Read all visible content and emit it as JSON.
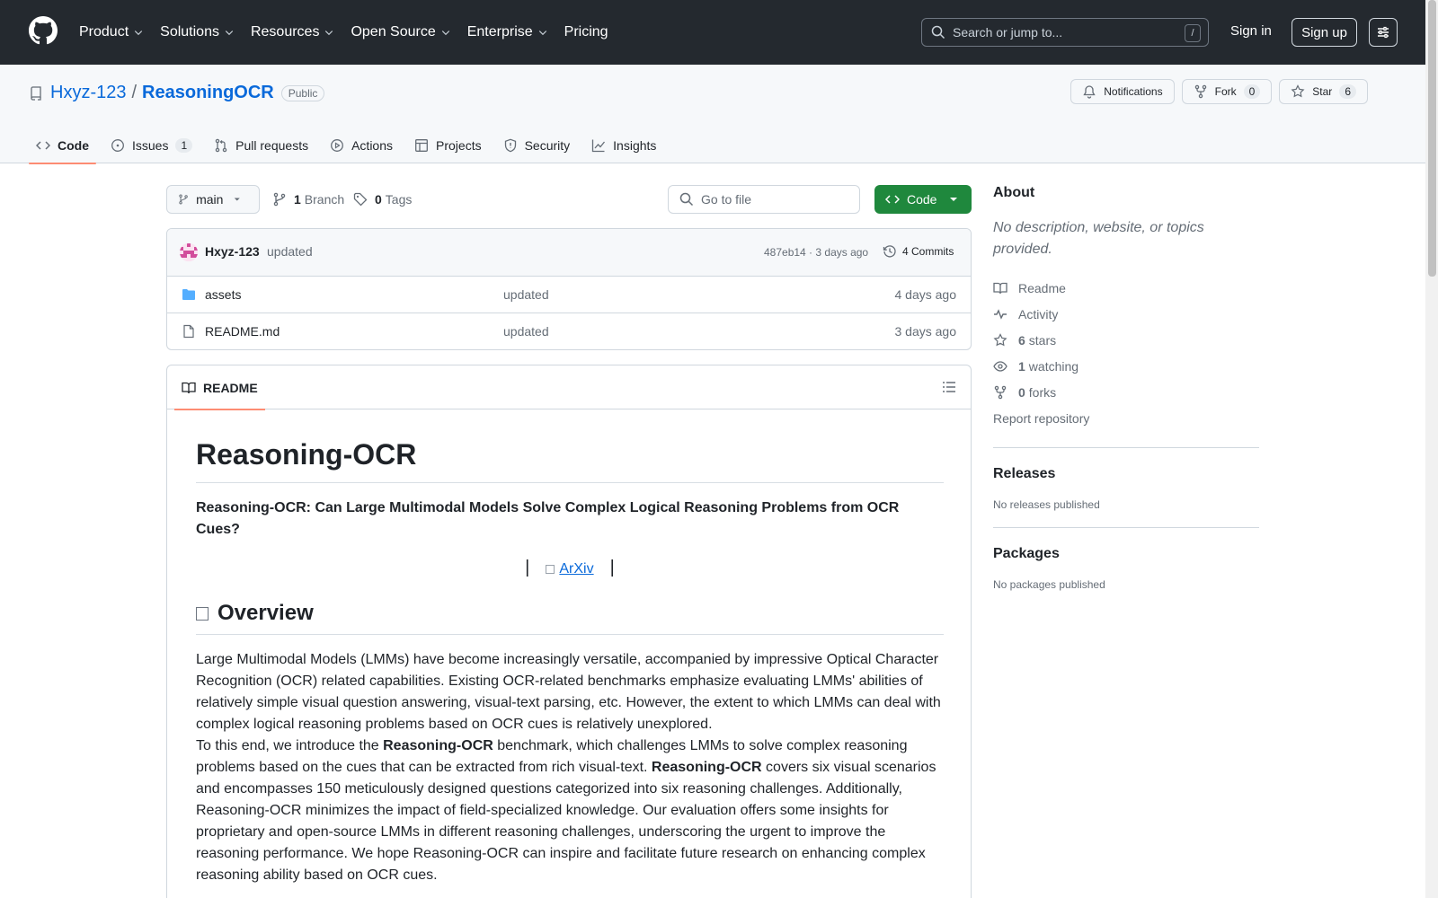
{
  "header": {
    "nav": [
      {
        "label": "Product",
        "has_menu": true
      },
      {
        "label": "Solutions",
        "has_menu": true
      },
      {
        "label": "Resources",
        "has_menu": true
      },
      {
        "label": "Open Source",
        "has_menu": true
      },
      {
        "label": "Enterprise",
        "has_menu": true
      },
      {
        "label": "Pricing",
        "has_menu": false
      }
    ],
    "search_placeholder": "Search or jump to...",
    "search_shortcut": "/",
    "sign_in": "Sign in",
    "sign_up": "Sign up"
  },
  "repo": {
    "owner": "Hxyz-123",
    "separator": "/",
    "name": "ReasoningOCR",
    "visibility": "Public",
    "notifications_label": "Notifications",
    "fork_label": "Fork",
    "fork_count": "0",
    "star_label": "Star",
    "star_count": "6"
  },
  "tabs": [
    {
      "label": "Code",
      "icon": "code-icon",
      "active": true
    },
    {
      "label": "Issues",
      "icon": "issue-icon",
      "count": "1"
    },
    {
      "label": "Pull requests",
      "icon": "pull-request-icon"
    },
    {
      "label": "Actions",
      "icon": "play-icon"
    },
    {
      "label": "Projects",
      "icon": "table-icon"
    },
    {
      "label": "Security",
      "icon": "shield-icon"
    },
    {
      "label": "Insights",
      "icon": "graph-icon"
    }
  ],
  "branch": {
    "current": "main",
    "branches_count": "1",
    "branches_label": "Branch",
    "tags_count": "0",
    "tags_label": "Tags",
    "go_to_file": "Go to file",
    "code_button": "Code"
  },
  "latest_commit": {
    "author": "Hxyz-123",
    "message": "updated",
    "meta": "487eb14 · 3 days ago",
    "commits_label": "4 Commits"
  },
  "files": [
    {
      "type": "folder",
      "name": "assets",
      "message": "updated",
      "date": "4 days ago"
    },
    {
      "type": "file",
      "name": "README.md",
      "message": "updated",
      "date": "3 days ago"
    }
  ],
  "readme": {
    "tab_label": "README",
    "title": "Reasoning-OCR",
    "subtitle": "Reasoning-OCR: Can Large Multimodal Models Solve Complex Logical Reasoning Problems from OCR Cues?",
    "bar_left": "|",
    "arxiv_label": "ArXiv",
    "bar_right": "|",
    "overview_heading": "Overview",
    "p1": "Large Multimodal Models (LMMs) have become increasingly versatile, accompanied by impressive Optical Character Recognition (OCR) related capabilities. Existing OCR-related benchmarks emphasize evaluating LMMs' abilities of relatively simple visual question answering, visual-text parsing, etc. However, the extent to which LMMs can deal with complex logical reasoning problems based on OCR cues is relatively unexplored.",
    "p2_a": "To this end, we introduce the ",
    "p2_b": "Reasoning-OCR",
    "p2_c": " benchmark, which challenges LMMs to solve complex reasoning problems based on the cues that can be extracted from rich visual-text. ",
    "p2_d": "Reasoning-OCR",
    "p2_e": " covers six visual scenarios and encompasses 150 meticulously designed questions categorized into six reasoning challenges. Additionally, Reasoning-OCR minimizes the impact of field-specialized knowledge. Our evaluation offers some insights for proprietary and open-source LMMs in different reasoning challenges, underscoring the urgent to improve the reasoning performance. We hope Reasoning-OCR can inspire and facilitate future research on enhancing complex reasoning ability based on OCR cues."
  },
  "about": {
    "heading": "About",
    "description": "No description, website, or topics provided.",
    "readme": "Readme",
    "activity": "Activity",
    "stars_count": "6",
    "stars_label": "stars",
    "watching_count": "1",
    "watching_label": "watching",
    "forks_count": "0",
    "forks_label": "forks",
    "report": "Report repository"
  },
  "releases": {
    "heading": "Releases",
    "empty": "No releases published"
  },
  "packages": {
    "heading": "Packages",
    "empty": "No packages published"
  },
  "colors": {
    "header_bg": "#24292f",
    "link": "#0969da",
    "primary_button": "#1f883d",
    "tab_underline": "#fd8c73"
  }
}
